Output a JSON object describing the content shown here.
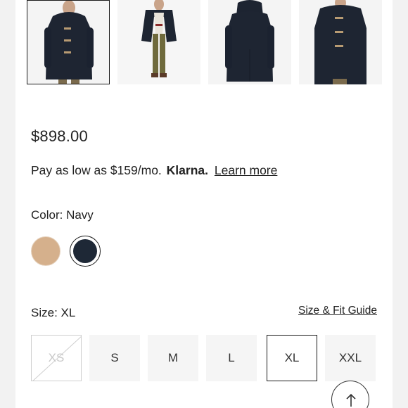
{
  "product": {
    "price": "$898.00",
    "financing": {
      "text": "Pay as low as $159/mo.",
      "provider": "Klarna.",
      "link": "Learn more"
    },
    "color": {
      "label": "Color: Navy",
      "swatches": [
        {
          "name": "Camel",
          "color": "#d5b08c"
        },
        {
          "name": "Navy",
          "color": "#1e2836",
          "selected": true
        }
      ]
    },
    "size": {
      "label": "Size: XL",
      "guide_link": "Size & Fit Guide",
      "options": [
        "XS",
        "S",
        "M",
        "L",
        "XL",
        "XXL"
      ],
      "selected": "XL",
      "unavailable": [
        "XS"
      ]
    }
  },
  "gallery": {
    "thumbnails": [
      "front view",
      "model wearing coat open",
      "back view",
      "front close-up"
    ],
    "selected_index": 0
  },
  "icons": {
    "scroll_top": "arrow-up-icon"
  }
}
